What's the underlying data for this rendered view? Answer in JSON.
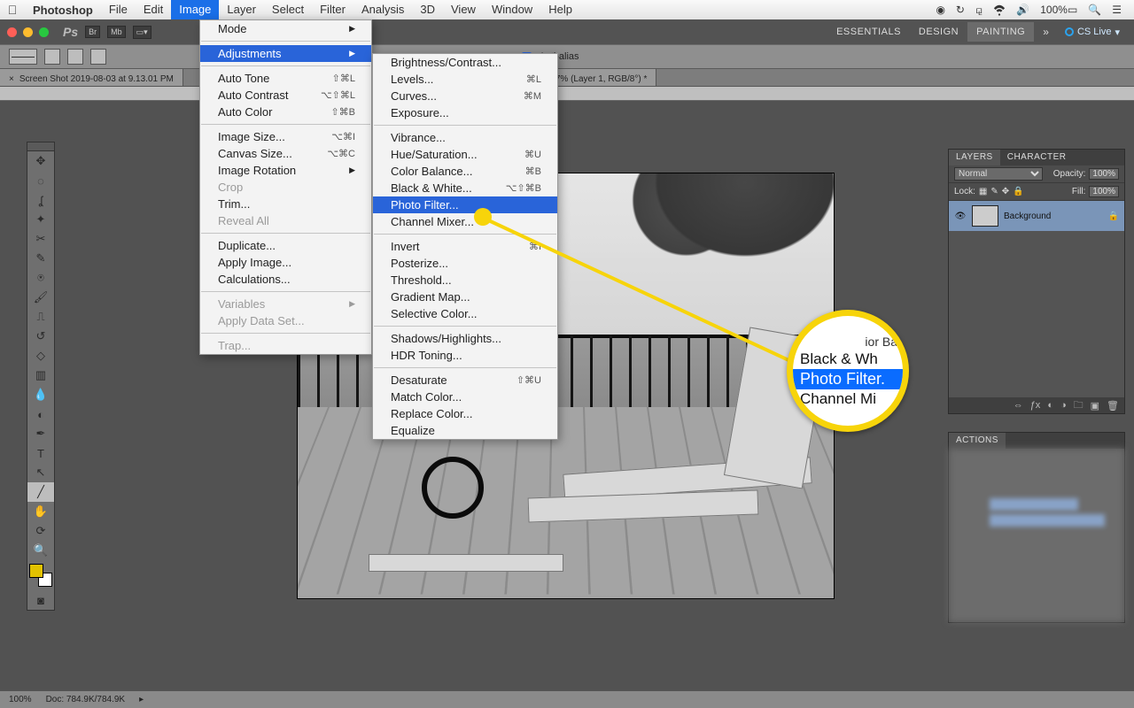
{
  "mac_menu": {
    "app": "Photoshop",
    "items": [
      "File",
      "Edit",
      "Image",
      "Layer",
      "Select",
      "Filter",
      "Analysis",
      "3D",
      "View",
      "Window",
      "Help"
    ],
    "selected": "Image",
    "battery": "100%"
  },
  "workspaces": {
    "items": [
      "ESSENTIALS",
      "DESIGN",
      "PAINTING"
    ],
    "active": "PAINTING",
    "cslive": "CS Live"
  },
  "options": {
    "antialias": "Anti-alias"
  },
  "doc_tabs": {
    "tab1": "Screen Shot 2019-08-03 at 9.13.01 PM",
    "tab2": "7% (Layer 1, RGB/8°) *"
  },
  "image_menu": {
    "items": [
      {
        "label": "Mode",
        "arrow": true
      },
      {
        "sep": true
      },
      {
        "label": "Adjustments",
        "arrow": true,
        "hl": true
      },
      {
        "sep": true
      },
      {
        "label": "Auto Tone",
        "sc": "⇧⌘L"
      },
      {
        "label": "Auto Contrast",
        "sc": "⌥⇧⌘L"
      },
      {
        "label": "Auto Color",
        "sc": "⇧⌘B"
      },
      {
        "sep": true
      },
      {
        "label": "Image Size...",
        "sc": "⌥⌘I"
      },
      {
        "label": "Canvas Size...",
        "sc": "⌥⌘C"
      },
      {
        "label": "Image Rotation",
        "arrow": true
      },
      {
        "label": "Crop",
        "disabled": true
      },
      {
        "label": "Trim..."
      },
      {
        "label": "Reveal All",
        "disabled": true
      },
      {
        "sep": true
      },
      {
        "label": "Duplicate..."
      },
      {
        "label": "Apply Image..."
      },
      {
        "label": "Calculations..."
      },
      {
        "sep": true
      },
      {
        "label": "Variables",
        "arrow": true,
        "disabled": true
      },
      {
        "label": "Apply Data Set...",
        "disabled": true
      },
      {
        "sep": true
      },
      {
        "label": "Trap...",
        "disabled": true
      }
    ]
  },
  "adjustments_menu": {
    "items": [
      {
        "label": "Brightness/Contrast..."
      },
      {
        "label": "Levels...",
        "sc": "⌘L"
      },
      {
        "label": "Curves...",
        "sc": "⌘M"
      },
      {
        "label": "Exposure..."
      },
      {
        "sep": true
      },
      {
        "label": "Vibrance..."
      },
      {
        "label": "Hue/Saturation...",
        "sc": "⌘U"
      },
      {
        "label": "Color Balance...",
        "sc": "⌘B"
      },
      {
        "label": "Black & White...",
        "sc": "⌥⇧⌘B"
      },
      {
        "label": "Photo Filter...",
        "hl": true
      },
      {
        "label": "Channel Mixer..."
      },
      {
        "sep": true
      },
      {
        "label": "Invert",
        "sc": "⌘I"
      },
      {
        "label": "Posterize..."
      },
      {
        "label": "Threshold..."
      },
      {
        "label": "Gradient Map..."
      },
      {
        "label": "Selective Color..."
      },
      {
        "sep": true
      },
      {
        "label": "Shadows/Highlights..."
      },
      {
        "label": "HDR Toning..."
      },
      {
        "sep": true
      },
      {
        "label": "Desaturate",
        "sc": "⇧⌘U"
      },
      {
        "label": "Match Color..."
      },
      {
        "label": "Replace Color..."
      },
      {
        "label": "Equalize"
      }
    ]
  },
  "callout": {
    "top_partial": "ior Ba",
    "bw": "Black & Wh",
    "pf": "Photo Filter.",
    "cm": "Channel Mi"
  },
  "layers_panel": {
    "tabs": [
      "LAYERS",
      "CHARACTER"
    ],
    "blend": "Normal",
    "opacity_label": "Opacity:",
    "opacity": "100%",
    "lock_label": "Lock:",
    "fill_label": "Fill:",
    "fill": "100%",
    "layer_name": "Background"
  },
  "actions_panel": {
    "tabs": [
      "ACTIONS"
    ]
  },
  "status": {
    "zoom": "100%",
    "doc": "Doc: 784.9K/784.9K"
  }
}
